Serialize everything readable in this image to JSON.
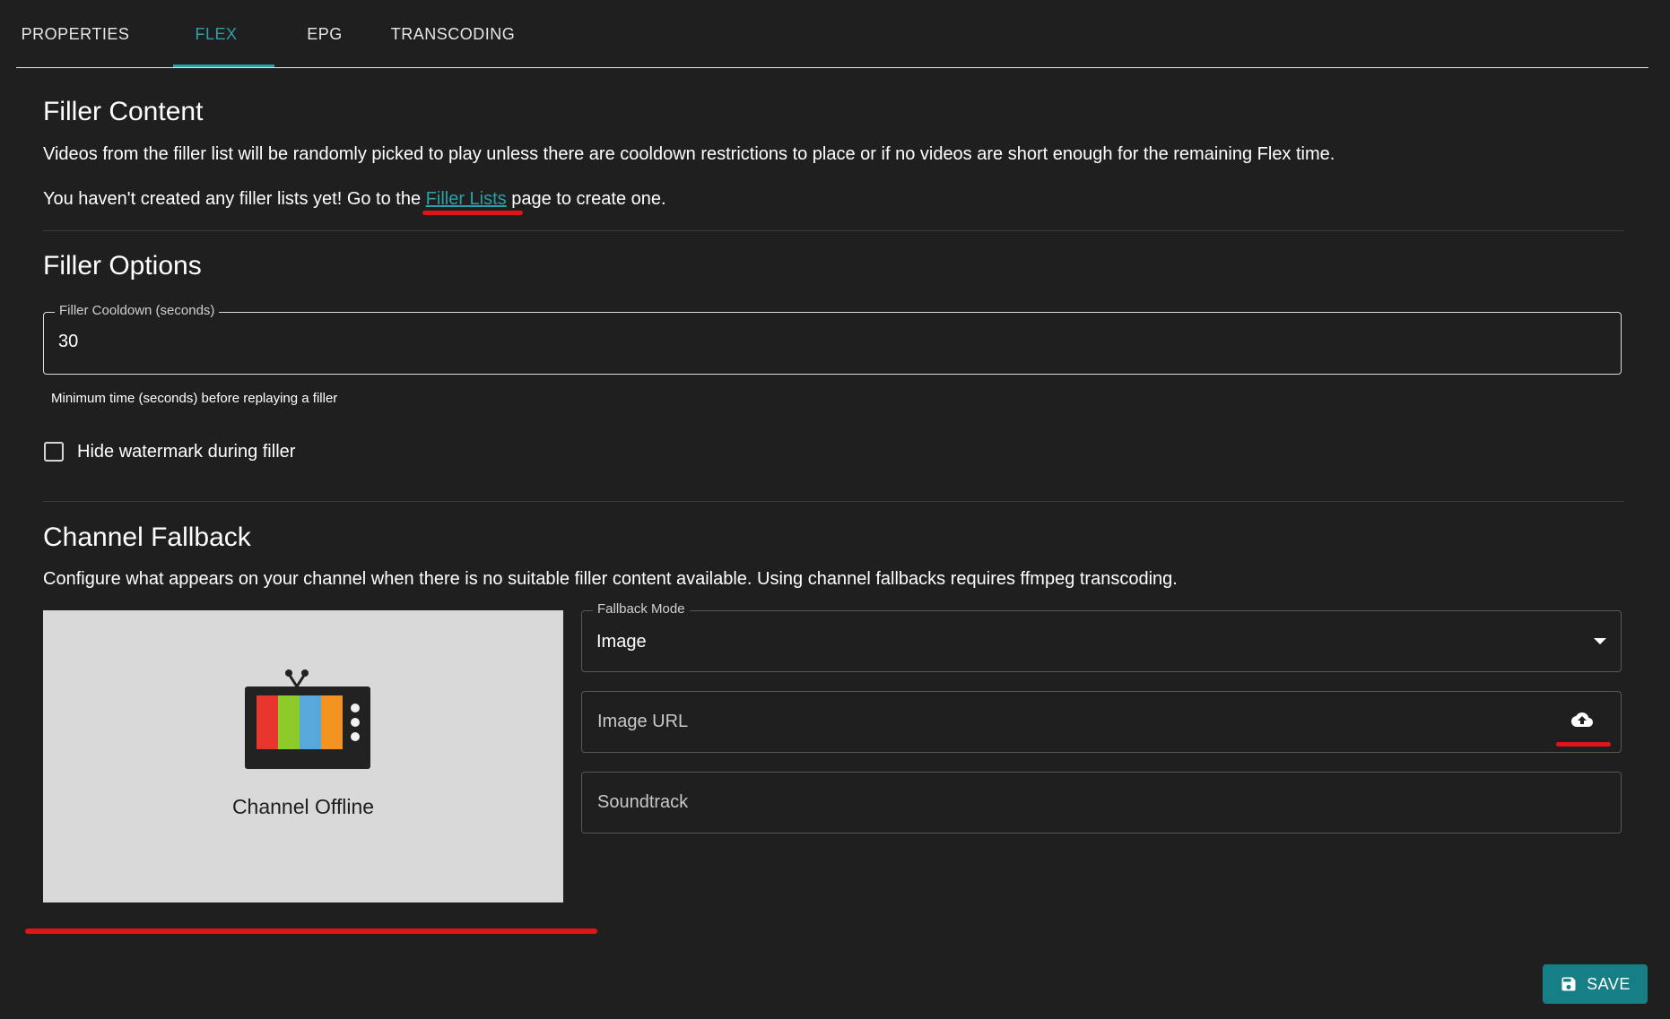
{
  "tabs": [
    {
      "label": "PROPERTIES"
    },
    {
      "label": "FLEX"
    },
    {
      "label": "EPG"
    },
    {
      "label": "TRANSCODING"
    }
  ],
  "active_tab": "FLEX",
  "filler_content": {
    "title": "Filler Content",
    "description": "Videos from the filler list will be randomly picked to play unless there are cooldown restrictions to place or if no videos are short enough for the remaining Flex time.",
    "empty_prefix": "You haven't created any filler lists yet! Go to the ",
    "empty_link": "Filler Lists",
    "empty_suffix": " page to create one."
  },
  "filler_options": {
    "title": "Filler Options",
    "cooldown_label": "Filler Cooldown (seconds)",
    "cooldown_value": "30",
    "cooldown_helper": "Minimum time (seconds) before replaying a filler",
    "hide_watermark_label": "Hide watermark during filler",
    "hide_watermark_checked": false
  },
  "channel_fallback": {
    "title": "Channel Fallback",
    "description": "Configure what appears on your channel when there is no suitable filler content available. Using channel fallbacks requires ffmpeg transcoding.",
    "preview_caption": "Channel Offline",
    "fallback_mode_label": "Fallback Mode",
    "fallback_mode_value": "Image",
    "image_url_placeholder": "Image URL",
    "soundtrack_placeholder": "Soundtrack",
    "upload_icon": "cloud-upload-icon"
  },
  "save_label": "SAVE",
  "colors": {
    "accent": "#2aa1a8",
    "save_button": "#167f86",
    "annotation_red": "#e0141b",
    "background": "#1f1f1f"
  }
}
